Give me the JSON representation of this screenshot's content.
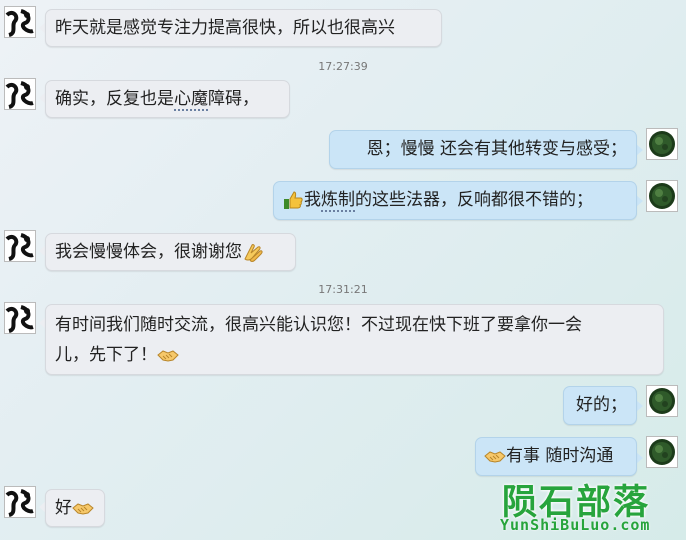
{
  "messages": [
    {
      "side": "in",
      "text": "昨天就是感觉专注力提高很快，所以也很高兴"
    },
    {
      "timestamp": "17:27:39"
    },
    {
      "side": "in",
      "text_a": "确实，反复也是",
      "text_dotted": "心魔",
      "text_b": "障碍，"
    },
    {
      "side": "out",
      "text": "恩；慢慢 还会有其他转变与感受；"
    },
    {
      "side": "out",
      "text_a": "我",
      "text_dotted": "炼制",
      "text_b": "的这些法器，反响都很不错的；",
      "emoji": "thumbs-up-icon"
    },
    {
      "side": "in",
      "text": "我会慢慢体会，很谢谢您",
      "emoji": "clap-hands-icon"
    },
    {
      "timestamp": "17:31:21"
    },
    {
      "side": "in",
      "line1": "有时间我们随时交流，很高兴能认识您！不过现在快下班了要拿你一会",
      "line2": "儿，先下了！",
      "emoji": "handshake-icon"
    },
    {
      "side": "out",
      "text": "好的；"
    },
    {
      "side": "out",
      "text": "有事 随时沟通",
      "emoji": "handshake-icon"
    },
    {
      "side": "in",
      "text": "好",
      "emoji": "handshake-icon"
    }
  ],
  "watermark": {
    "title": "陨石部落",
    "subtitle": "YunShiBuLuo.com"
  },
  "colors": {
    "bubble_in": "#eceef2",
    "bubble_out": "#cbe5f7",
    "watermark": "#27a43c"
  }
}
